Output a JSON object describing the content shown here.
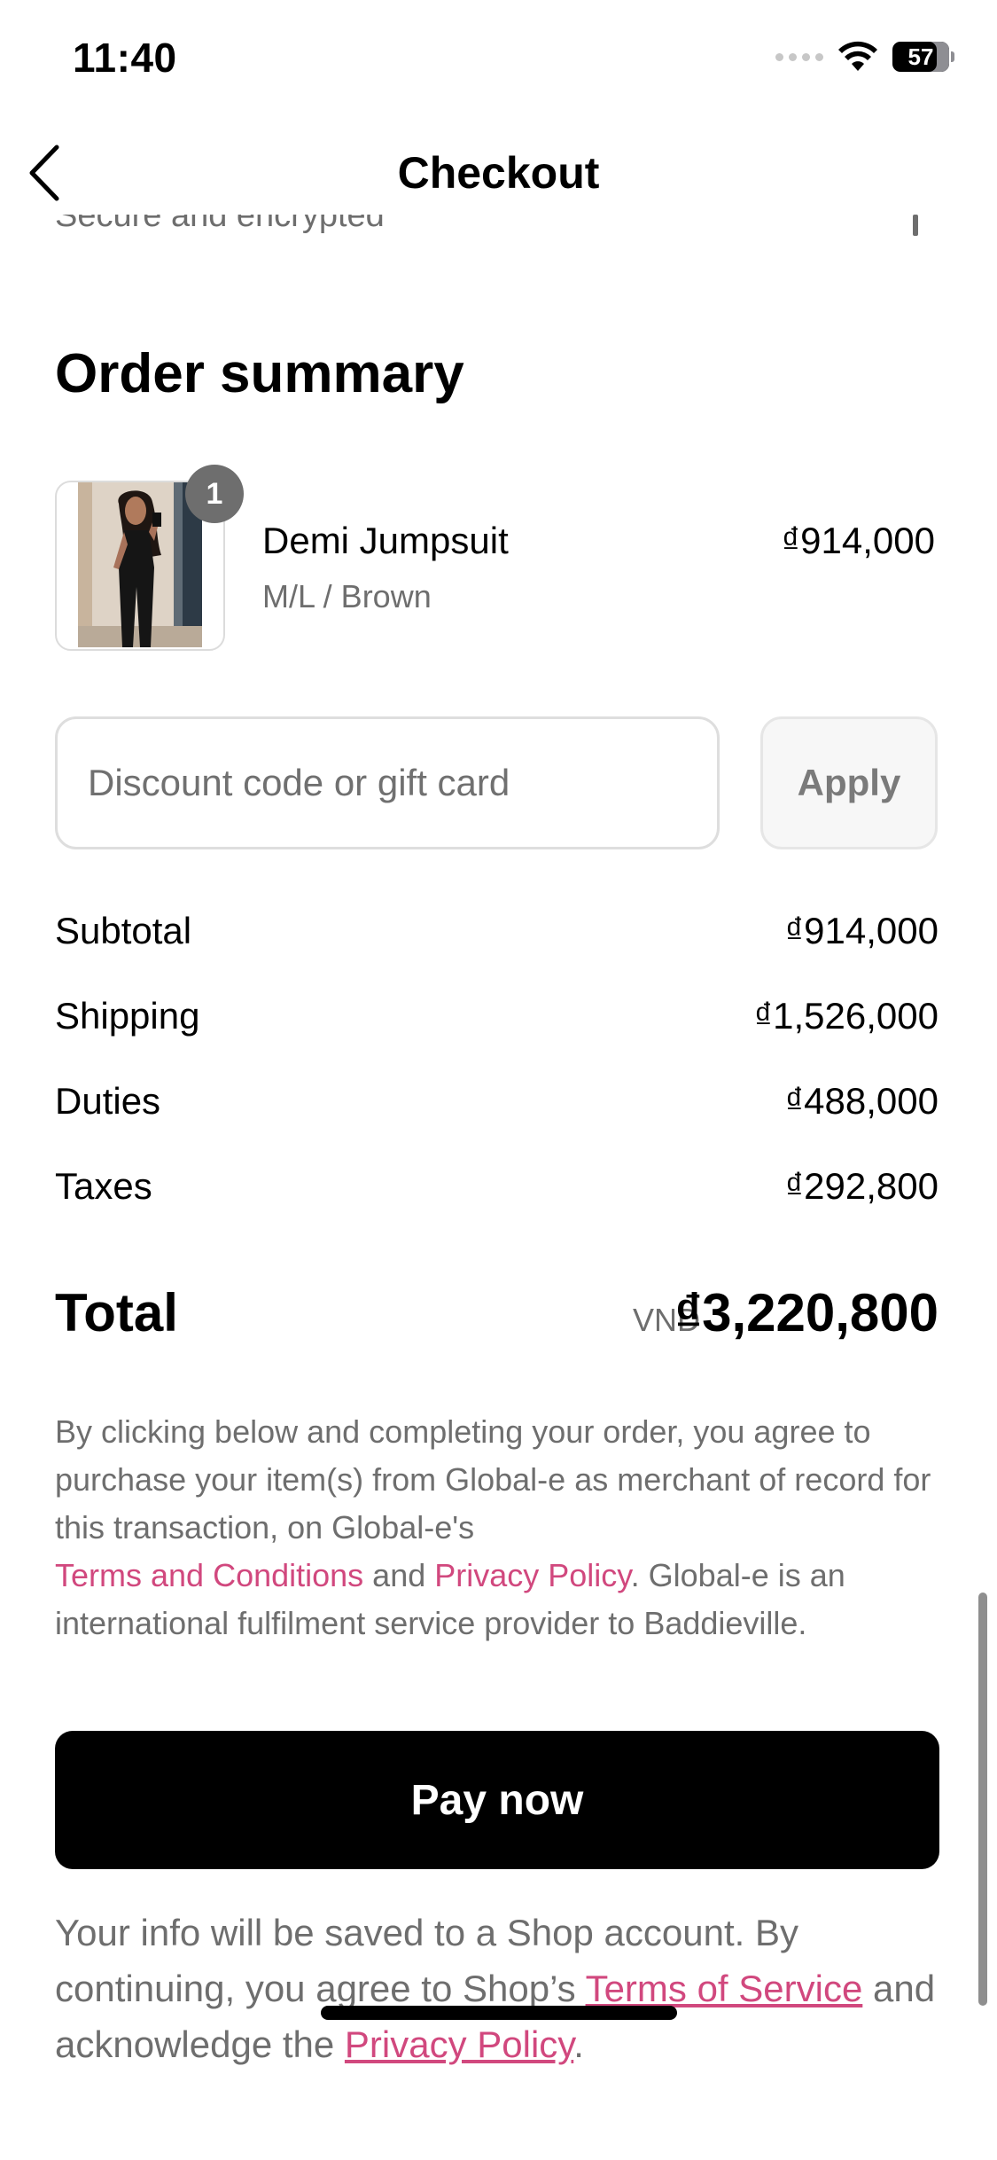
{
  "status_bar": {
    "time": "11:40",
    "battery": "57"
  },
  "header": {
    "title": "Checkout",
    "partial_text": "Secure and encrypted"
  },
  "order_summary": {
    "title": "Order summary",
    "item": {
      "quantity": "1",
      "name": "Demi Jumpsuit",
      "variant": "M/L / Brown",
      "price": "₫914,000"
    }
  },
  "discount": {
    "placeholder": "Discount code or gift card",
    "apply_label": "Apply"
  },
  "costs": {
    "subtotal_label": "Subtotal",
    "subtotal_value": "₫914,000",
    "shipping_label": "Shipping",
    "shipping_value": "₫1,526,000",
    "duties_label": "Duties",
    "duties_value": "₫488,000",
    "taxes_label": "Taxes",
    "taxes_value": "₫292,800"
  },
  "total": {
    "label": "Total",
    "currency": "VND",
    "value": "₫3,220,800"
  },
  "legal": {
    "part1": "By clicking below and completing your order, you agree to purchase your item(s) from Global-e as merchant of record for this transaction, on Global-e's",
    "terms_link": "Terms and Conditions",
    "and_text": " and ",
    "privacy_link": "Privacy Policy",
    "part2": ". Global-e is an international fulfilment service provider to Baddieville."
  },
  "pay_button": "Pay now",
  "shop_note": {
    "part1": "Your info will be saved to a Shop account. By continuing, you agree to Shop’s ",
    "terms_link": "Terms of Service",
    "part2": " and acknowledge the ",
    "privacy_link": "Privacy Policy",
    "part3": "."
  },
  "colors": {
    "accent_pink": "#d1487e",
    "button_black": "#000000",
    "muted_text": "#6e6e6e"
  },
  "icons": [
    "back-chevron-icon",
    "cellular-signal-icon",
    "wifi-icon",
    "battery-icon"
  ]
}
